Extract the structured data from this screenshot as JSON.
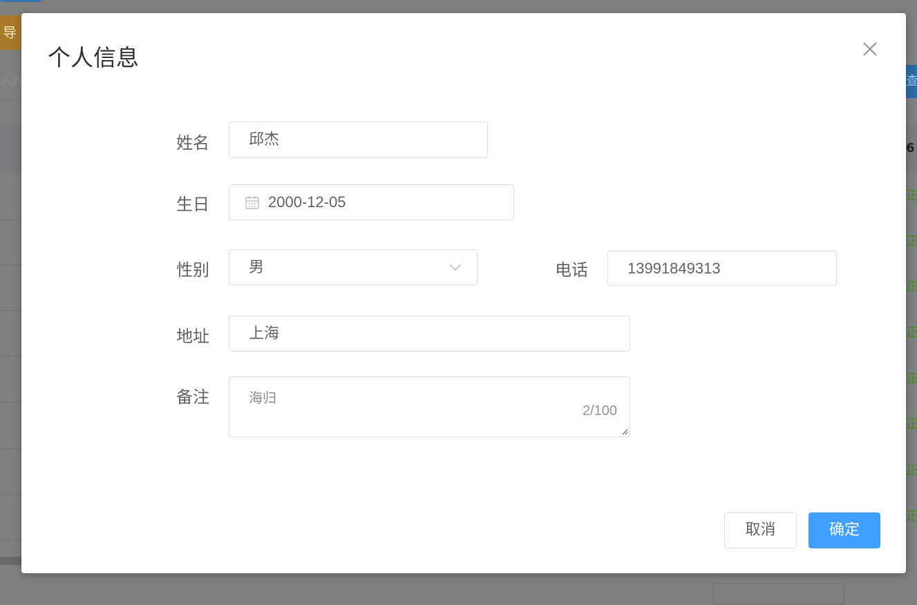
{
  "background": {
    "export_button_label": "导出",
    "search_placeholder_fragment": "入姓",
    "right_header_fragment": "6",
    "right_button_fragment": "查",
    "status_tag_fragment": "正"
  },
  "dialog": {
    "title": "个人信息",
    "close_icon": "close-icon",
    "fields": {
      "name": {
        "label": "姓名",
        "value": "邱杰"
      },
      "birthday": {
        "label": "生日",
        "value": "2000-12-05",
        "icon": "calendar-icon"
      },
      "gender": {
        "label": "性别",
        "value": "男",
        "icon": "chevron-down-icon"
      },
      "phone": {
        "label": "电话",
        "value": "13991849313"
      },
      "address": {
        "label": "地址",
        "value": "上海"
      },
      "remark": {
        "label": "备注",
        "value": "海归",
        "counter": "2/100"
      }
    },
    "buttons": {
      "cancel": "取消",
      "confirm": "确定"
    }
  },
  "colors": {
    "primary": "#409eff",
    "border": "#dcdfe6",
    "overlay": "#808080",
    "text": "#606266"
  }
}
